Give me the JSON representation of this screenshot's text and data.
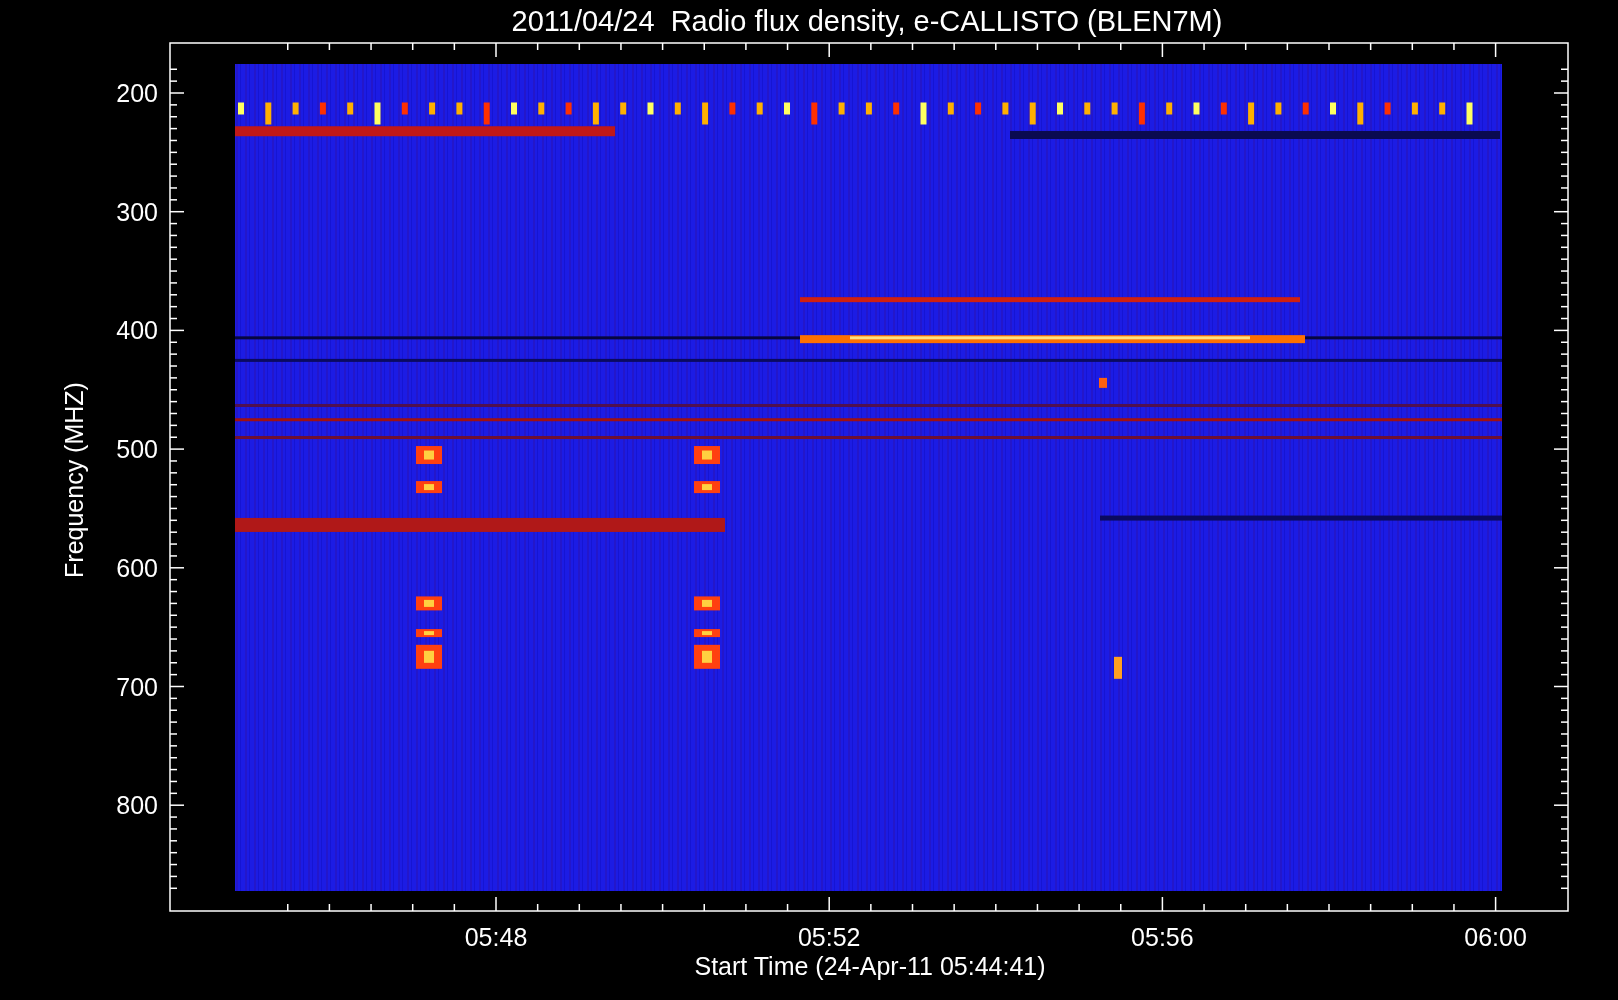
{
  "title": "2011/04/24  Radio flux density, e-CALLISTO (BLEN7M)",
  "y_axis": {
    "label": "Frequency (MHZ)",
    "ticks": [
      "200",
      "300",
      "400",
      "500",
      "600",
      "700",
      "800"
    ]
  },
  "x_axis": {
    "label": "Start Time (24-Apr-11 05:44:41)",
    "ticks": [
      "05:48",
      "05:52",
      "05:56",
      "06:00"
    ]
  }
}
